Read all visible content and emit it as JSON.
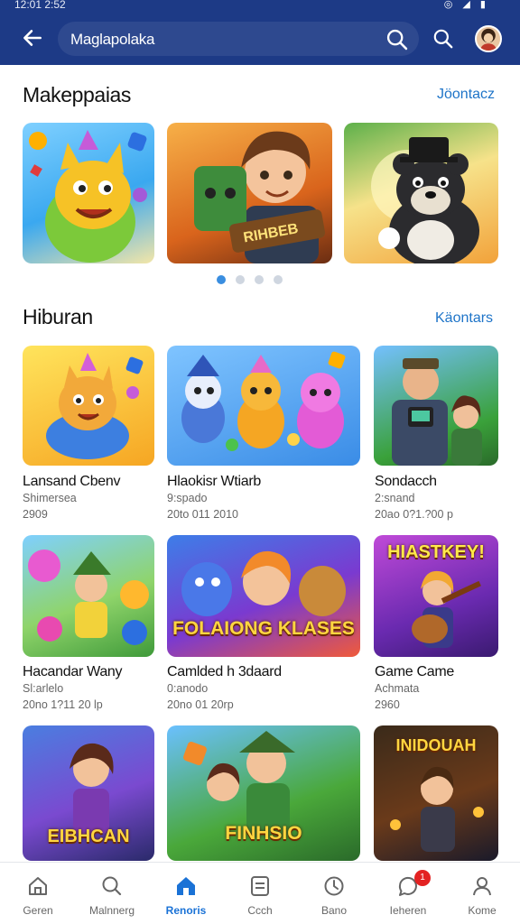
{
  "status_bar": {
    "time": "12:01 2:52",
    "icons": "◎ ◢ ▮"
  },
  "header": {
    "search_value": "Maglapolaka"
  },
  "sections": {
    "featured": {
      "title": "Makeppaias",
      "link": "Jöontacz"
    },
    "hiburan": {
      "title": "Hiburan",
      "link": "Käontars"
    }
  },
  "banner_text": "RIHBEB",
  "carousel": {
    "active_index": 0,
    "count": 4
  },
  "cards": [
    {
      "title": "Lansand Cbenv",
      "sub": "Shimersea",
      "meta": "2909"
    },
    {
      "title": "Hlaokisr Wtiarb",
      "sub": "9:spado",
      "meta": "20to 011 2010"
    },
    {
      "title": "Sondacch",
      "sub": "2:snand",
      "meta": "20ao 0?1.?00 p"
    },
    {
      "title": "Hacandar Wany",
      "sub": "Sl:arlelo",
      "meta": "20no 1?11 20 lp"
    },
    {
      "title": "Camlded h 3daard",
      "sub": "0:anodo",
      "meta": "20no 01 20rp"
    },
    {
      "title": "Game Came",
      "sub": "Achmata",
      "meta": "2960"
    }
  ],
  "card_art_text": {
    "c5": "FOLAIONG KLASES",
    "c6": "HIASTKEY!",
    "c7": "EIBHCAN",
    "c8": "FINHSIO",
    "c9": "INIDOUAH"
  },
  "bottom_nav": [
    {
      "label": "Geren",
      "icon": "home-outline-icon"
    },
    {
      "label": "Malnnerg",
      "icon": "search-icon"
    },
    {
      "label": "Renoris",
      "icon": "home-filled-icon",
      "active": true
    },
    {
      "label": "Ccch",
      "icon": "document-icon"
    },
    {
      "label": "Bano",
      "icon": "clock-icon"
    },
    {
      "label": "Ieheren",
      "icon": "chat-icon",
      "badge": "1"
    },
    {
      "label": "Kome",
      "icon": "profile-icon"
    }
  ],
  "colors": {
    "header": "#1d3a86",
    "accent": "#1e74c8",
    "active_nav": "#1a72d6",
    "badge": "#e32222"
  }
}
